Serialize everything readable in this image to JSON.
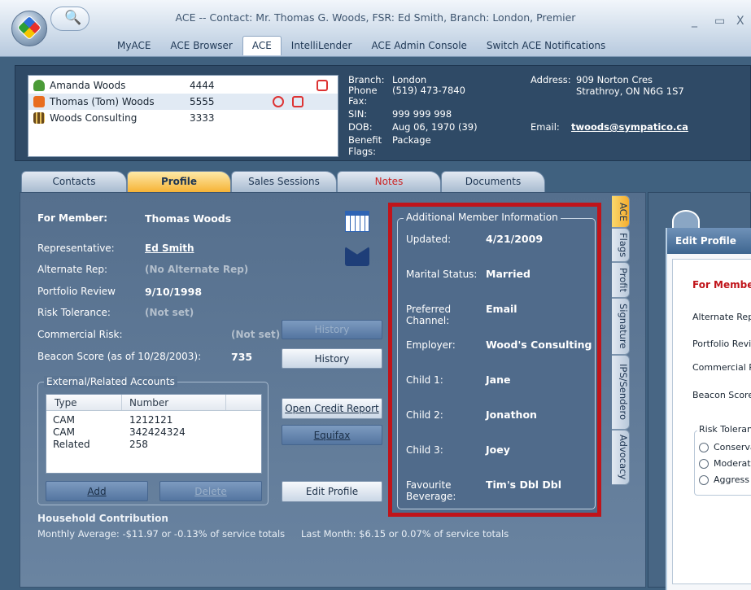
{
  "window": {
    "title": "ACE -- Contact: Mr. Thomas G. Woods, FSR: Ed Smith, Branch: London, Premier",
    "ctl_min": "_",
    "ctl_max": "▭",
    "ctl_close": "X"
  },
  "menu": [
    "MyACE",
    "ACE Browser",
    "ACE",
    "IntelliLender",
    "ACE Admin Console",
    "Switch ACE Notifications"
  ],
  "contacts": [
    {
      "name": "Amanda Woods",
      "number": "4444"
    },
    {
      "name": "Thomas (Tom) Woods",
      "number": "5555"
    },
    {
      "name": "Woods Consulting",
      "number": "3333"
    }
  ],
  "header": {
    "branch_label": "Branch:",
    "branch": "London",
    "phone_label": "Phone",
    "phone": "(519) 473-7840",
    "fax_label": "Fax:",
    "sin_label": "SIN:",
    "sin": "999 999 998",
    "dob_label": "DOB:",
    "dob": "Aug 06, 1970  (39)",
    "benefit_label": "Benefit",
    "benefit": "Package",
    "flags_label": "Flags:",
    "address_label": "Address:",
    "address1": "909 Norton Cres",
    "address2": "Strathroy, ON N6G 1S7",
    "email_label": "Email:",
    "email": "twoods@sympatico.ca"
  },
  "tabs": [
    "Contacts",
    "Profile",
    "Sales Sessions",
    "Notes",
    "Documents"
  ],
  "profile": {
    "for_member_label": "For Member:",
    "for_member": "Thomas Woods",
    "rep_label": "Representative:",
    "rep": "Ed Smith",
    "alt_rep_label": "Alternate Rep:",
    "alt_rep": "(No Alternate Rep)",
    "portfolio_label": "Portfolio Review",
    "portfolio": "9/10/1998",
    "risk_label": "Risk Tolerance:",
    "risk": "(Not set)",
    "commercial_label": "Commercial Risk:",
    "commercial": "(Not set)",
    "beacon_label": "Beacon Score (as of 10/28/2003):",
    "beacon": "735",
    "history1": "History",
    "history2": "History",
    "ext_legend": "External/Related Accounts",
    "acct_cols": [
      "Type",
      "Number"
    ],
    "accounts": [
      {
        "type": "CAM",
        "number": "1212121"
      },
      {
        "type": "CAM",
        "number": "342424324"
      },
      {
        "type": "Related",
        "number": "258"
      }
    ],
    "add": "Add",
    "delete": "Delete",
    "open_credit": "Open Credit Report",
    "equifax": "Equifax",
    "edit_profile": "Edit Profile",
    "household_title": "Household Contribution",
    "household_monthly": "Monthly Average: -$11.97 or -0.13% of service totals",
    "household_last": "Last Month: $6.15 or 0.07% of service totals"
  },
  "additional": {
    "legend": "Additional Member Information",
    "rows": [
      {
        "label": "Updated:",
        "value": "4/21/2009"
      },
      {
        "label": "Marital Status:",
        "value": "Married"
      },
      {
        "label": "Preferred Channel:",
        "value": "Email"
      },
      {
        "label": "Employer:",
        "value": "Wood's Consulting"
      },
      {
        "label": "Child 1:",
        "value": "Jane"
      },
      {
        "label": "Child 2:",
        "value": "Jonathon"
      },
      {
        "label": "Child 3:",
        "value": "Joey"
      },
      {
        "label": "Favourite Beverage:",
        "value": "Tim's Dbl Dbl"
      }
    ]
  },
  "side_tabs": [
    "ACE",
    "Flags",
    "Profit",
    "Signature",
    "IPS/Sendero",
    "Advocacy"
  ],
  "edit_profile": {
    "title": "Edit Profile",
    "for_member": "For Member:",
    "alt_rep": "Alternate Rep:",
    "portfolio": "Portfolio Revie",
    "commercial": "Commercial Ri",
    "beacon": "Beacon Score",
    "risk_legend": "Risk Toleranc",
    "risk_options": [
      "Conserva",
      "Moderate",
      "Aggress"
    ]
  },
  "colors": {
    "highlight_border": "#c0141a",
    "active_tab": "#f6b336",
    "panel": "#5b7593"
  }
}
